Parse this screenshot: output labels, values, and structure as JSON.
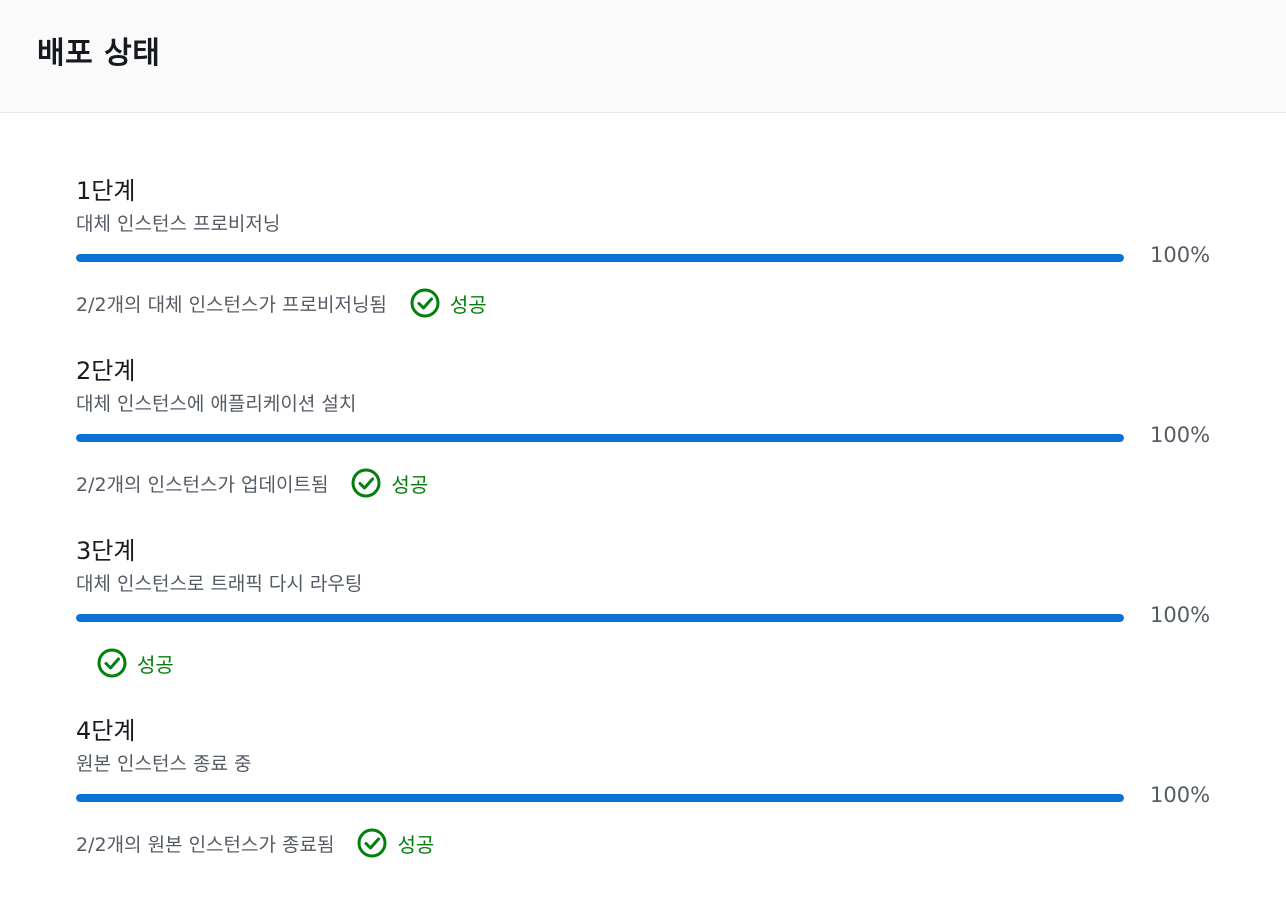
{
  "header": {
    "title": "배포 상태"
  },
  "colors": {
    "progress": "#0972d3",
    "success": "#037f0c",
    "text_secondary": "#545b64"
  },
  "stages": [
    {
      "title": "1단계",
      "description": "대체 인스턴스 프로비저닝",
      "progress": 100,
      "progress_label": "100%",
      "status_text": "2/2개의 대체 인스턴스가 프로비저닝됨",
      "status_label": "성공",
      "status_icon": "check-circle-icon"
    },
    {
      "title": "2단계",
      "description": "대체 인스턴스에 애플리케이션 설치",
      "progress": 100,
      "progress_label": "100%",
      "status_text": "2/2개의 인스턴스가 업데이트됨",
      "status_label": "성공",
      "status_icon": "check-circle-icon"
    },
    {
      "title": "3단계",
      "description": "대체 인스턴스로 트래픽 다시 라우팅",
      "progress": 100,
      "progress_label": "100%",
      "status_text": "",
      "status_label": "성공",
      "status_icon": "check-circle-icon"
    },
    {
      "title": "4단계",
      "description": "원본 인스턴스 종료 중",
      "progress": 100,
      "progress_label": "100%",
      "status_text": "2/2개의 원본 인스턴스가 종료됨",
      "status_label": "성공",
      "status_icon": "check-circle-icon"
    }
  ]
}
